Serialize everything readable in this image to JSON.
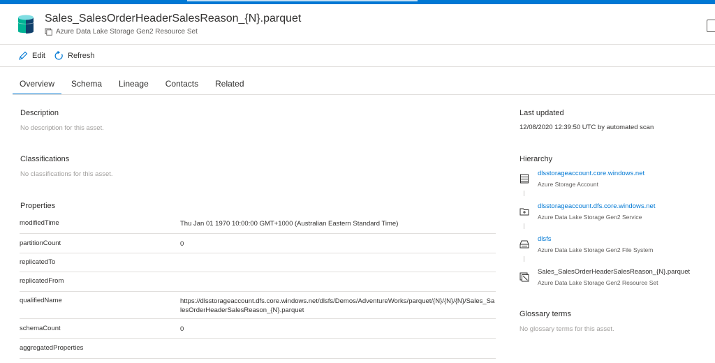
{
  "colors": {
    "accent": "#0078d4",
    "link": "#0078d4",
    "muted": "#a19f9d",
    "divider": "#e1dfdd"
  },
  "header": {
    "title": "Sales_SalesOrderHeaderSalesReason_{N}.parquet",
    "subtitle": "Azure Data Lake Storage Gen2 Resource Set",
    "icon": "database-cylinder-icon"
  },
  "toolbar": {
    "edit_label": "Edit",
    "refresh_label": "Refresh"
  },
  "tabs": [
    {
      "label": "Overview",
      "active": true
    },
    {
      "label": "Schema",
      "active": false
    },
    {
      "label": "Lineage",
      "active": false
    },
    {
      "label": "Contacts",
      "active": false
    },
    {
      "label": "Related",
      "active": false
    }
  ],
  "description": {
    "title": "Description",
    "empty": "No description for this asset."
  },
  "classifications": {
    "title": "Classifications",
    "empty": "No classifications for this asset."
  },
  "properties": {
    "title": "Properties",
    "rows": [
      {
        "key": "modifiedTime",
        "value": "Thu Jan 01 1970 10:00:00 GMT+1000 (Australian Eastern Standard Time)"
      },
      {
        "key": "partitionCount",
        "value": "0"
      },
      {
        "key": "replicatedTo",
        "value": ""
      },
      {
        "key": "replicatedFrom",
        "value": ""
      },
      {
        "key": "qualifiedName",
        "value": "https://dlsstorageaccount.dfs.core.windows.net/dlsfs/Demos/AdventureWorks/parquet/{N}/{N}/{N}/Sales_SalesOrderHeaderSalesReason_{N}.parquet"
      },
      {
        "key": "schemaCount",
        "value": "0"
      },
      {
        "key": "aggregatedProperties",
        "value": ""
      }
    ]
  },
  "last_updated": {
    "title": "Last updated",
    "value": "12/08/2020 12:39:50 UTC by automated scan"
  },
  "hierarchy": {
    "title": "Hierarchy",
    "items": [
      {
        "name": "dlsstorageaccount.core.windows.net",
        "type": "Azure Storage Account",
        "icon": "storage-account-icon",
        "link": true
      },
      {
        "name": "dlsstorageaccount.dfs.core.windows.net",
        "type": "Azure Data Lake Storage Gen2 Service",
        "icon": "folder-service-icon",
        "link": true
      },
      {
        "name": "dlsfs",
        "type": "Azure Data Lake Storage Gen2 File System",
        "icon": "file-system-icon",
        "link": true
      },
      {
        "name": "Sales_SalesOrderHeaderSalesReason_{N}.parquet",
        "type": "Azure Data Lake Storage Gen2 Resource Set",
        "icon": "resource-set-icon",
        "link": false
      }
    ]
  },
  "glossary": {
    "title": "Glossary terms",
    "empty": "No glossary terms for this asset."
  }
}
